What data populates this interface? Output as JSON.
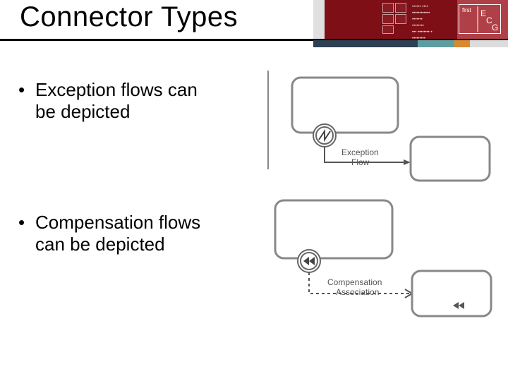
{
  "header": {
    "title": "Connector Types",
    "tiny_lines": [
      "•••••• ••••",
      "••••••••••••",
      "•••••••",
      "••••••••",
      "••• •••••••• •",
      "•••••••••"
    ],
    "logo_text_top": "first",
    "logo_text_right": "ECG"
  },
  "bullets": {
    "item1_line1": "Exception flows can",
    "item1_line2": "be depicted",
    "item2_line1": "Compensation flows",
    "item2_line2": "can be depicted"
  },
  "diagram1": {
    "label_line1": "Exception",
    "label_line2": "Flow"
  },
  "diagram2": {
    "label_line1": "Compensation",
    "label_line2": "Association"
  },
  "colors": {
    "dark_red": "#7f0f17",
    "navy": "#2e3f52",
    "teal": "#5f9ea0",
    "orange": "#d88a2f"
  }
}
